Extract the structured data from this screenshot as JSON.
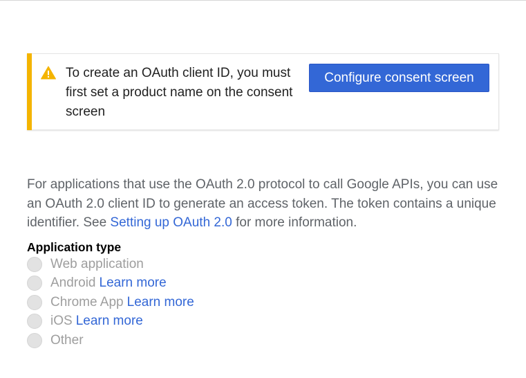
{
  "notice": {
    "message": "To create an OAuth client ID, you must first set a product name on the consent screen",
    "button_label": "Configure consent screen",
    "accent_color": "#f4b400",
    "icon": "warning-icon"
  },
  "description": {
    "text_before_link": "For applications that use the OAuth 2.0 protocol to call Google APIs, you can use an OAuth 2.0 client ID to generate an access token. The token contains a unique identifier. See ",
    "link_text": "Setting up OAuth 2.0",
    "text_after_link": " for more information."
  },
  "application_type": {
    "heading": "Application type",
    "options": [
      {
        "label": "Web application",
        "link": ""
      },
      {
        "label": "Android",
        "link": "Learn more"
      },
      {
        "label": "Chrome App",
        "link": "Learn more"
      },
      {
        "label": "iOS",
        "link": "Learn more"
      },
      {
        "label": "Other",
        "link": ""
      }
    ]
  },
  "colors": {
    "link": "#3367d6",
    "button": "#3367d6"
  }
}
